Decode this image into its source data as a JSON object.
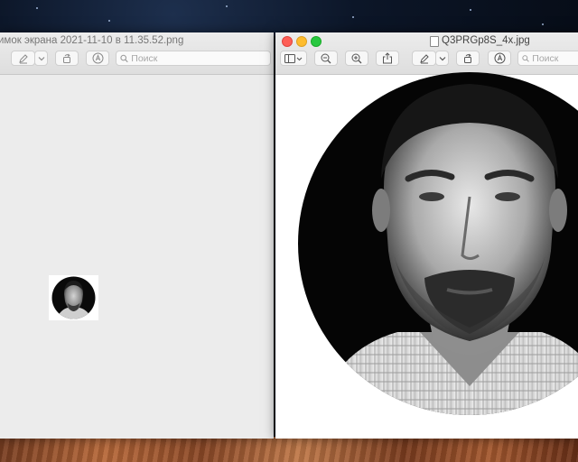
{
  "left_window": {
    "title": "имок экрана 2021-11-10 в 11.35.52.png",
    "search_placeholder": "Поиск"
  },
  "right_window": {
    "title": "Q3PRGp8S_4x.jpg",
    "search_placeholder": "Поиск"
  },
  "icons": [
    "sidebar-icon",
    "zoom-out-icon",
    "zoom-in-icon",
    "share-icon",
    "markup-pencil-icon",
    "rotate-icon",
    "annotate-icon",
    "search-icon"
  ],
  "colors": {
    "close": "#fe5f57",
    "minimize": "#febc2e",
    "maximize": "#28c840"
  }
}
